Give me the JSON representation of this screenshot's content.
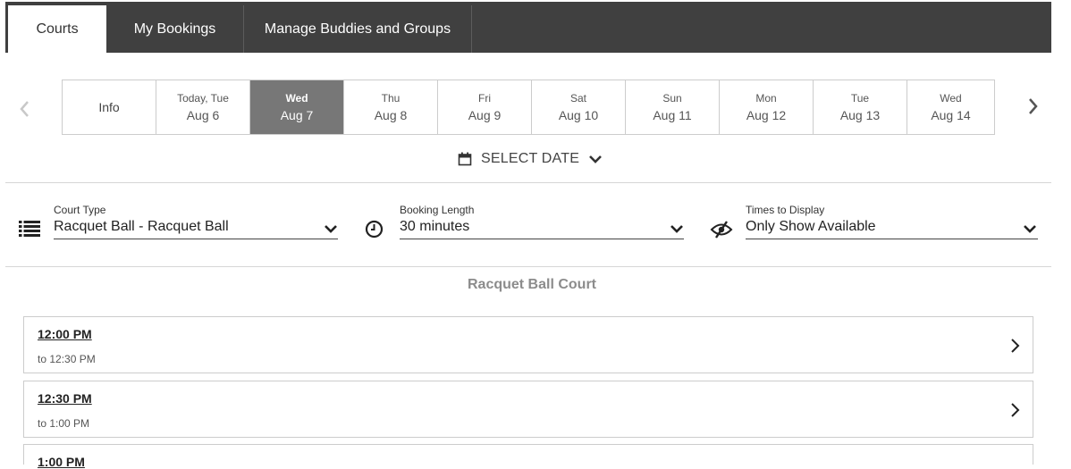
{
  "tabs": [
    {
      "label": "Courts"
    },
    {
      "label": "My Bookings"
    },
    {
      "label": "Manage Buddies and Groups"
    }
  ],
  "dates": {
    "info_label": "Info",
    "days": [
      {
        "dow": "Today, Tue",
        "dm": "Aug 6"
      },
      {
        "dow": "Wed",
        "dm": "Aug 7"
      },
      {
        "dow": "Thu",
        "dm": "Aug 8"
      },
      {
        "dow": "Fri",
        "dm": "Aug 9"
      },
      {
        "dow": "Sat",
        "dm": "Aug 10"
      },
      {
        "dow": "Sun",
        "dm": "Aug 11"
      },
      {
        "dow": "Mon",
        "dm": "Aug 12"
      },
      {
        "dow": "Tue",
        "dm": "Aug 13"
      },
      {
        "dow": "Wed",
        "dm": "Aug 14"
      }
    ],
    "selected_index": 1
  },
  "select_date_label": "SELECT DATE",
  "filters": {
    "court_type": {
      "label": "Court Type",
      "value": "Racquet Ball - Racquet Ball"
    },
    "booking_length": {
      "label": "Booking Length",
      "value": "30 minutes"
    },
    "times_to_display": {
      "label": "Times to Display",
      "value": "Only Show Available"
    }
  },
  "court_title": "Racquet Ball Court",
  "slots": [
    {
      "start": "12:00 PM",
      "end": "to 12:30 PM"
    },
    {
      "start": "12:30 PM",
      "end": "to 1:00 PM"
    },
    {
      "start": "1:00 PM",
      "end": ""
    }
  ],
  "colors": {
    "topbar": "#404040",
    "selected_day": "#777777",
    "court_title": "#8c8c8c"
  },
  "icons": {
    "prev": "chevron-left-icon",
    "next": "chevron-right-icon",
    "calendar": "calendar-icon",
    "list": "list-icon",
    "clock": "clock-icon",
    "visibility": "eye-slash-icon"
  }
}
